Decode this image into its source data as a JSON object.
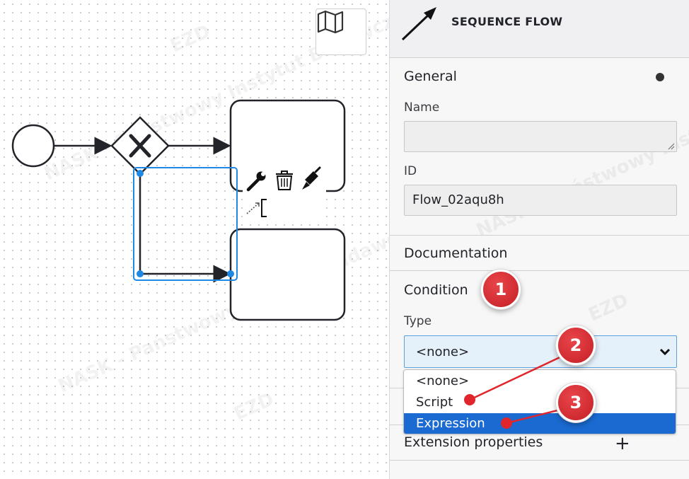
{
  "panel": {
    "header_title": "SEQUENCE FLOW",
    "groups": {
      "general": "General",
      "documentation": "Documentation",
      "condition": "Condition",
      "extension_properties": "Extension properties"
    },
    "name_label": "Name",
    "name_value": "",
    "id_label": "ID",
    "id_value": "Flow_02aqu8h",
    "type_label": "Type",
    "type_selected": "<none>",
    "type_options": [
      "<none>",
      "Script",
      "Expression"
    ],
    "highlighted_option": "Expression"
  },
  "annotations": {
    "badge_1": "1",
    "badge_2": "2",
    "badge_3": "3"
  },
  "watermark": {
    "brand": "EZD",
    "org": "NASK - Państwowy Instytut Badawczy"
  },
  "colors": {
    "selection_blue": "#1e88e5",
    "dropdown_highlight": "#1a6ad1",
    "badge_red": "#d62a30"
  },
  "icons": [
    "map-icon",
    "sequence-flow-arrow-icon",
    "wrench-icon",
    "trash-icon",
    "paintbrush-icon",
    "connect-icon",
    "annotation-icon",
    "add-icon",
    "gateway-x-icon"
  ]
}
